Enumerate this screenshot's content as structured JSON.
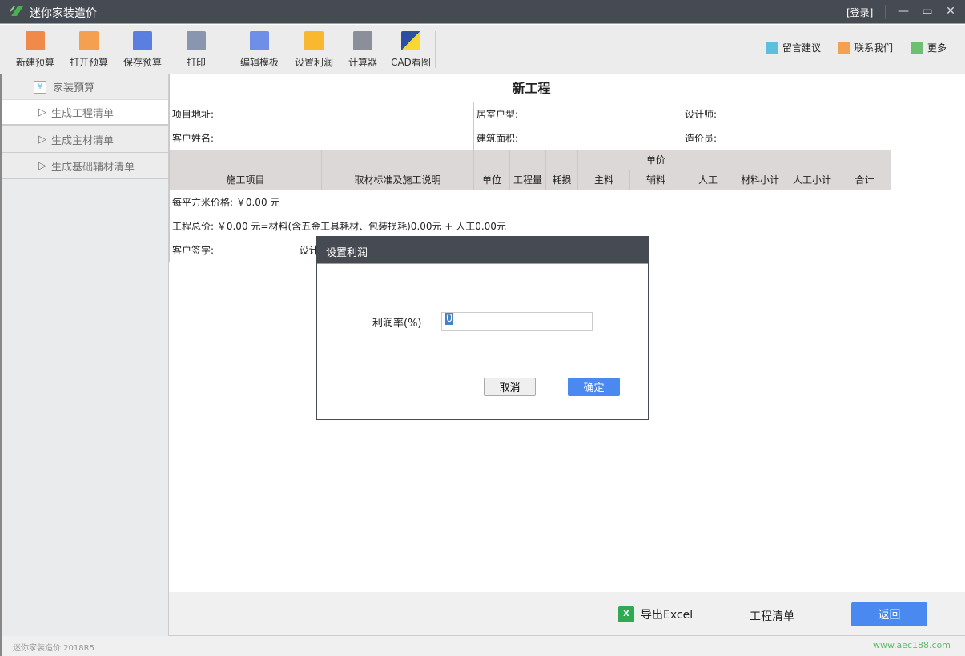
{
  "window": {
    "title": "迷你家装造价",
    "login": "[登录]"
  },
  "toolbar": {
    "items": [
      {
        "label": "新建预算",
        "icon": "new-file-icon",
        "color": "#f08a4b"
      },
      {
        "label": "打开预算",
        "icon": "open-file-icon",
        "color": "#f5a050"
      },
      {
        "label": "保存预算",
        "icon": "save-icon",
        "color": "#5b7fe0"
      },
      {
        "label": "打印",
        "icon": "print-icon",
        "color": "#8a96ad"
      },
      {
        "label": "编辑模板",
        "icon": "edit-template-icon",
        "color": "#6e8ee8"
      },
      {
        "label": "设置利润",
        "icon": "money-bag-icon",
        "color": "#f8b830"
      },
      {
        "label": "计算器",
        "icon": "calculator-icon",
        "color": "#8a8f99"
      },
      {
        "label": "CAD看图",
        "icon": "dwg-icon",
        "color": "#2c4fa0"
      }
    ],
    "right": [
      {
        "label": "留言建议",
        "icon": "feedback-icon",
        "color": "#5bc0de"
      },
      {
        "label": "联系我们",
        "icon": "mail-icon",
        "color": "#f5a050"
      },
      {
        "label": "更多",
        "icon": "more-icon",
        "color": "#6cc070"
      }
    ]
  },
  "sidebar": {
    "header": "家装预算",
    "items": [
      "生成工程清单",
      "生成主材清单",
      "生成基础辅材清单"
    ]
  },
  "sheet": {
    "title": "新工程",
    "info": [
      [
        "项目地址:",
        "居室户型:",
        "设计师:"
      ],
      [
        "客户姓名:",
        "建筑面积:",
        "造价员:"
      ]
    ],
    "group_header": "单价",
    "columns": [
      "施工项目",
      "取材标准及施工说明",
      "单位",
      "工程量",
      "耗损",
      "主料",
      "辅料",
      "人工",
      "材料小计",
      "人工小计",
      "合计"
    ],
    "per_sqm": "每平方米价格: ￥0.00 元",
    "total": "工程总价: ￥0.00 元=材料(含五金工具耗材、包装损耗)0.00元 + 人工0.00元",
    "customer_sign": "客户签字:",
    "designer_sign": "设计"
  },
  "bottom": {
    "export": "导出Excel",
    "list": "工程清单",
    "back": "返回"
  },
  "status": {
    "version": "迷你家装造价 2018R5",
    "website": "www.aec188.com"
  },
  "dialog": {
    "title": "设置利润",
    "label": "利润率(%)",
    "value": "0",
    "cancel": "取消",
    "ok": "确定"
  },
  "colors": {
    "titlebar": "#464a53",
    "accent": "#4a8af0",
    "green": "#6cc070"
  }
}
